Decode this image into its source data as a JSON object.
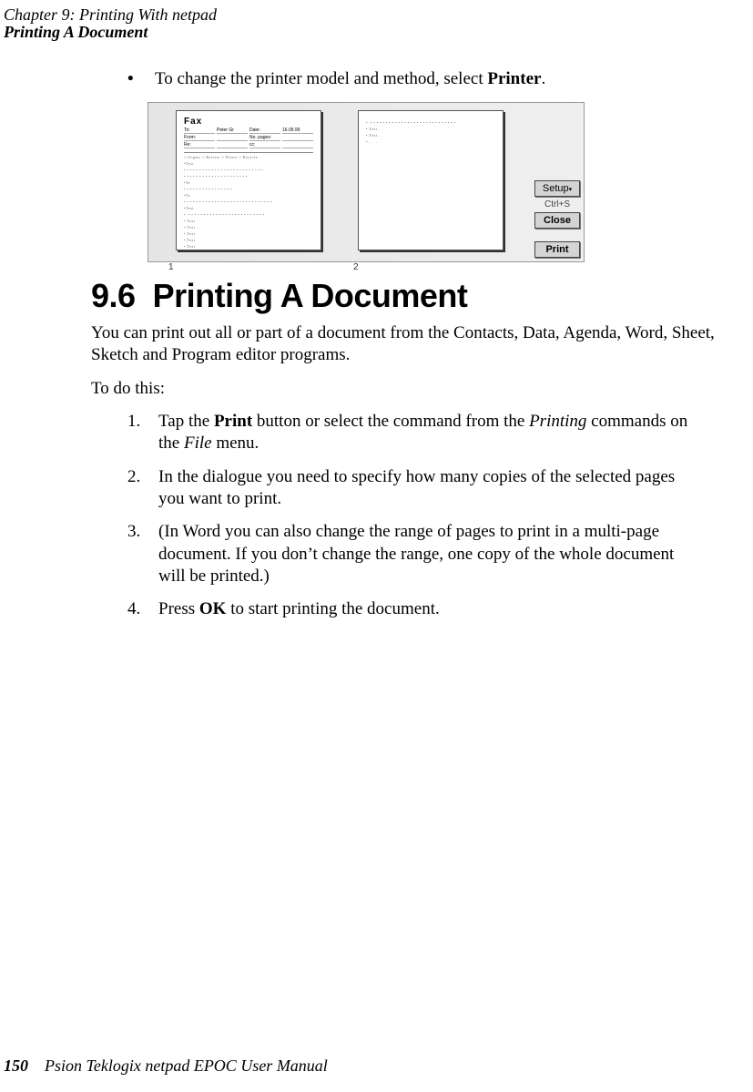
{
  "header": {
    "chapter": "Chapter 9:  Printing With netpad",
    "section_title": "Printing A Document"
  },
  "bullet": {
    "marker": "•",
    "text_before": "To change the printer model and method, select ",
    "bold": "Printer",
    "text_after": "."
  },
  "screenshot": {
    "page1": {
      "title": "Fax",
      "rows": [
        [
          "To:",
          "Peter Gr",
          "Date:",
          "16.09.99"
        ],
        [
          "From:",
          "",
          "No. pages:",
          ""
        ],
        [
          "Re:",
          "",
          "cc:",
          ""
        ]
      ],
      "checks": "□ Urgent    □ Review    □ Please    □ Recycle"
    },
    "page_labels": {
      "p1": "1",
      "p2": "2"
    },
    "buttons": {
      "setup": "Setup",
      "shortcut": "Ctrl+S",
      "close": "Close",
      "print": "Print"
    }
  },
  "section": {
    "number": "9.6",
    "title": "Printing A Document"
  },
  "para1": "You can print out all or part of a document from the Contacts, Data, Agenda, Word, Sheet, Sketch and Program editor programs.",
  "para2": "To do this:",
  "steps": [
    {
      "num": "1.",
      "segs": [
        {
          "t": "Tap the "
        },
        {
          "t": "Print",
          "b": true
        },
        {
          "t": " button or select the command from the "
        },
        {
          "t": "Printing",
          "i": true
        },
        {
          "t": " com­mands on the "
        },
        {
          "t": "File",
          "i": true
        },
        {
          "t": " menu."
        }
      ]
    },
    {
      "num": "2.",
      "segs": [
        {
          "t": "In the dialogue you need to specify how many copies of the selected pages you want to print."
        }
      ]
    },
    {
      "num": "3.",
      "segs": [
        {
          "t": "(In Word you can also change the range of pages to print in a multi-page document. If you don’t change the range, one copy of the whole document will be printed.)"
        }
      ]
    },
    {
      "num": "4.",
      "segs": [
        {
          "t": "Press "
        },
        {
          "t": "OK",
          "b": true
        },
        {
          "t": " to start printing the document."
        }
      ]
    }
  ],
  "footer": {
    "page": "150",
    "title": "Psion Teklogix netpad EPOC User Manual"
  }
}
